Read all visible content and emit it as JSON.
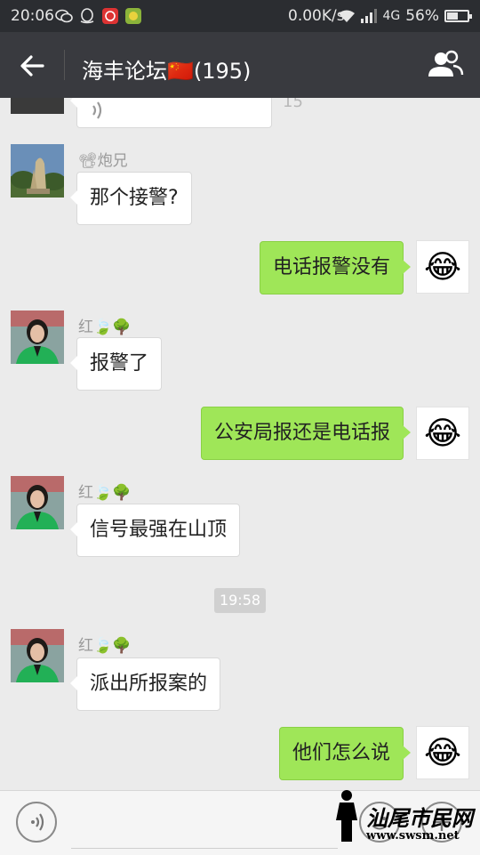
{
  "status_bar": {
    "time": "20:06",
    "speed": "0.00K/s",
    "network": "4G",
    "battery": "56%",
    "battery_level": 0.56
  },
  "header": {
    "title": "海丰论坛🇨🇳(195)"
  },
  "chat": {
    "voice_duration": "15",
    "timestamp": "19:58",
    "messages": [
      {
        "sender": "📽炮兄",
        "text": "那个接警?"
      },
      {
        "sender": "me",
        "text": "电话报警没有"
      },
      {
        "sender": "红🍃🌳",
        "text": "报警了"
      },
      {
        "sender": "me",
        "text": "公安局报还是电话报"
      },
      {
        "sender": "红🍃🌳",
        "text": "信号最强在山顶"
      },
      {
        "sender": "红🍃🌳",
        "text": "派出所报案的"
      },
      {
        "sender": "me",
        "text": "他们怎么说"
      }
    ],
    "my_avatar_emoji": "😂"
  },
  "watermark": {
    "name": "汕尾市民网",
    "url": "www.swsm.net"
  }
}
